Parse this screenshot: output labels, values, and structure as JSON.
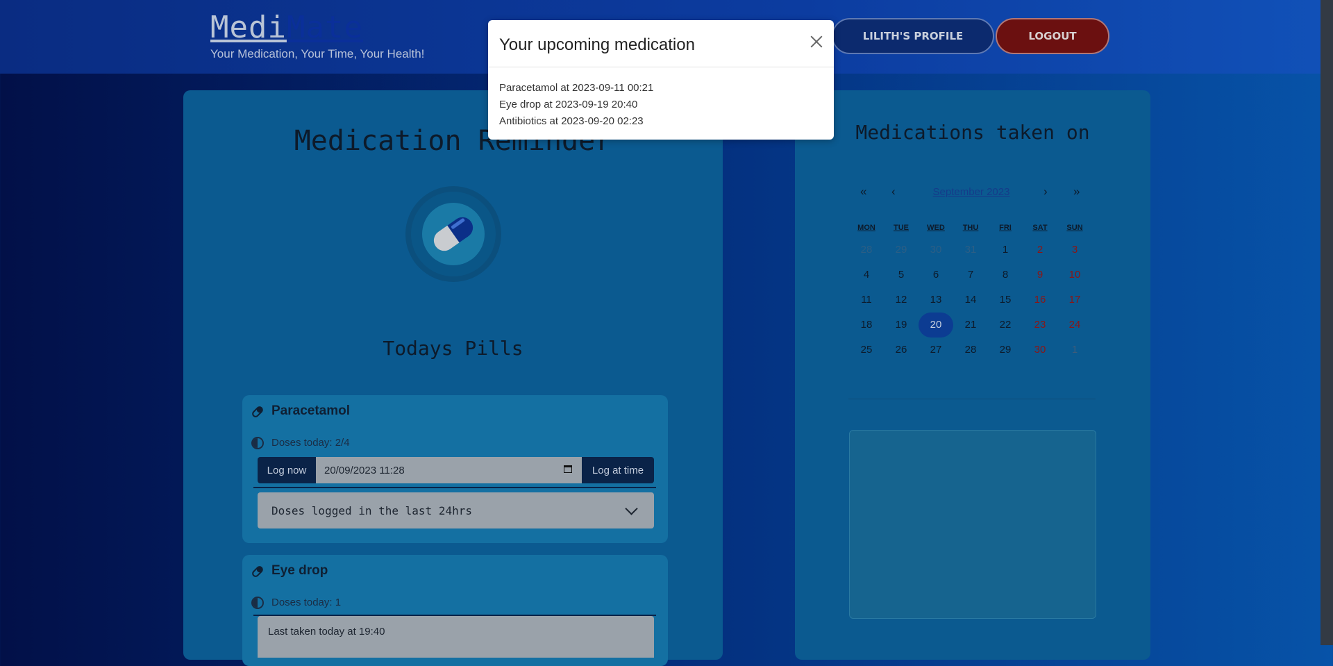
{
  "header": {
    "logo_part1": "Medi",
    "logo_part2": "Mate",
    "tagline": "Your Medication, Your Time, Your Health!",
    "profile_button": "LILITH'S PROFILE",
    "logout_button": "LOGOUT"
  },
  "main": {
    "title": "Medication Reminder",
    "subtitle": "Todays Pills",
    "pills": [
      {
        "name": "Paracetamol",
        "doses_today": "Doses today: 2/4",
        "log_now": "Log now",
        "datetime_value": "20/09/2023 11:28",
        "log_at_time": "Log at time",
        "accordion": "Doses logged in the last 24hrs"
      },
      {
        "name": "Eye drop",
        "doses_today": "Doses today: 1",
        "last_taken": "Last taken today at 19:40"
      }
    ]
  },
  "calendar": {
    "title": "Medications taken on",
    "nav_first": "«",
    "nav_prev": "‹",
    "month_label": "September 2023",
    "nav_next": "›",
    "nav_last": "»",
    "weekdays": [
      "MON",
      "TUE",
      "WED",
      "THU",
      "FRI",
      "SAT",
      "SUN"
    ],
    "weeks": [
      [
        "28",
        "29",
        "30",
        "31",
        "1",
        "2",
        "3"
      ],
      [
        "4",
        "5",
        "6",
        "7",
        "8",
        "9",
        "10"
      ],
      [
        "11",
        "12",
        "13",
        "14",
        "15",
        "16",
        "17"
      ],
      [
        "18",
        "19",
        "20",
        "21",
        "22",
        "23",
        "24"
      ],
      [
        "25",
        "26",
        "27",
        "28",
        "29",
        "30",
        "1"
      ]
    ],
    "today": "20"
  },
  "modal": {
    "title": "Your upcoming medication",
    "items": [
      "Paracetamol at 2023-09-11 00:21",
      "Eye drop at 2023-09-19 20:40",
      "Antibiotics at 2023-09-20 02:23"
    ]
  },
  "colors": {
    "accent": "#0c3c92",
    "logout": "#6b1010",
    "panel": "#0b5a90"
  }
}
